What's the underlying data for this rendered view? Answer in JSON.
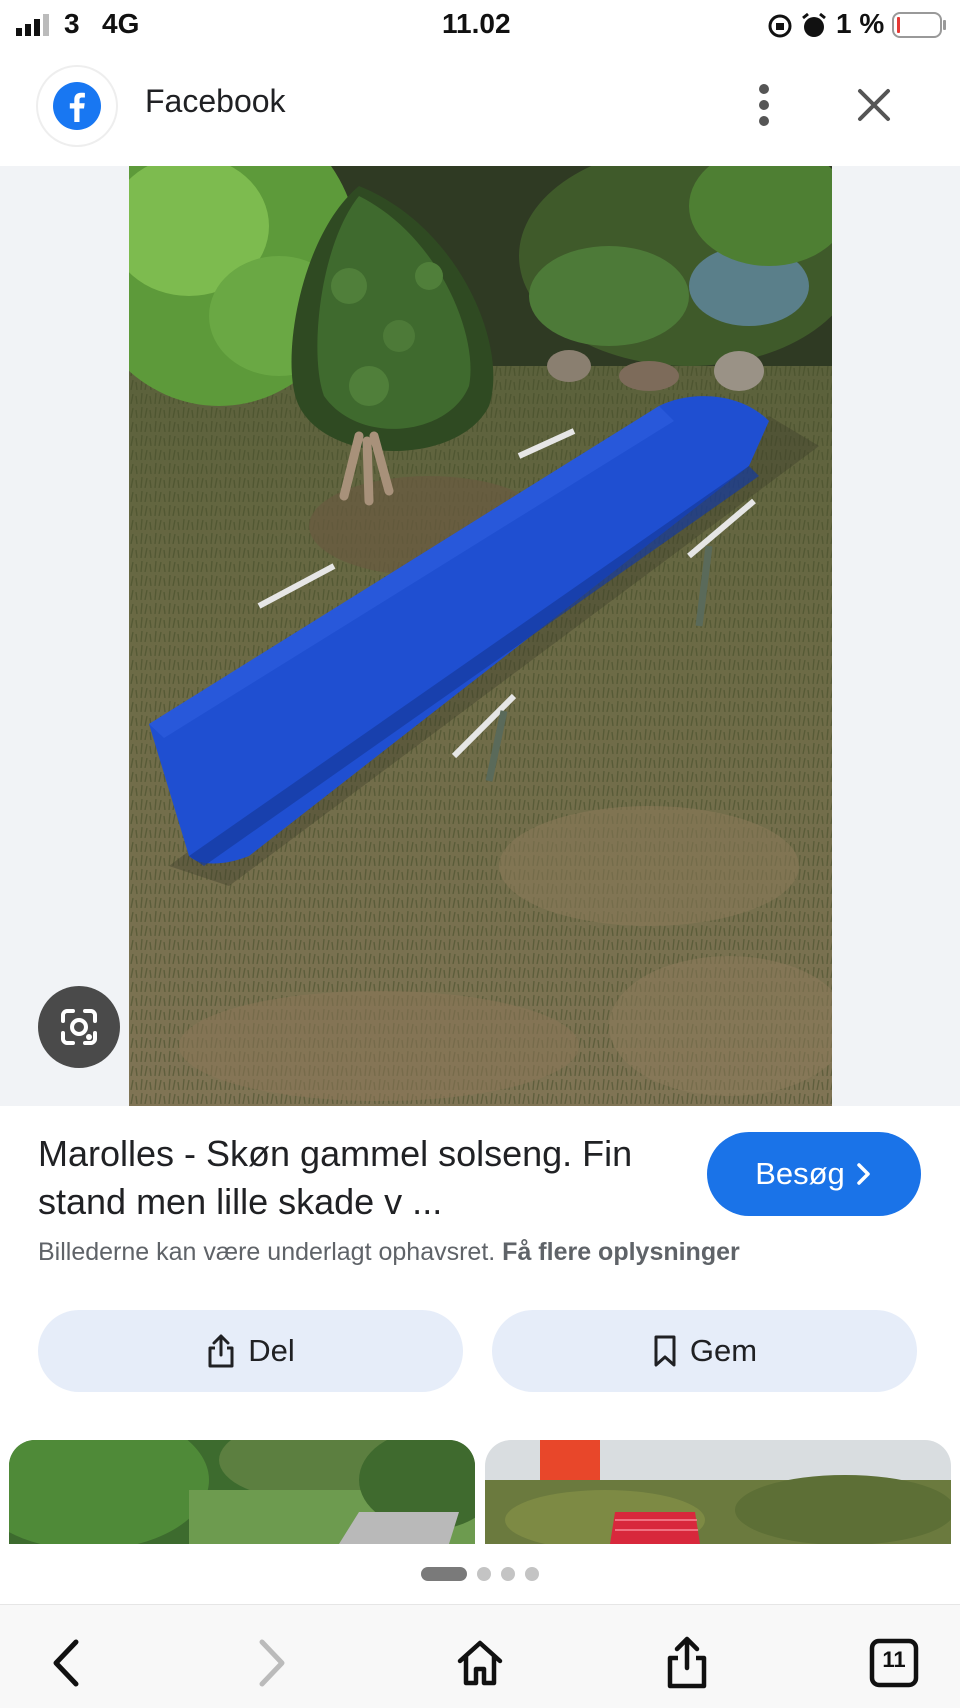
{
  "status_bar": {
    "carrier": "3",
    "network": "4G",
    "time": "11.02",
    "battery": "1 %"
  },
  "header": {
    "title": "Facebook",
    "icons": [
      "facebook-logo-icon",
      "more-vert-icon",
      "close-icon"
    ]
  },
  "result": {
    "title": "Marolles - Skøn gammel solseng. Fin stand men lille skade v ...",
    "visit_label": "Besøg",
    "notice_text": "Billederne kan være underlagt ophavsret.",
    "notice_link": "Få flere oplysninger",
    "share_label": "Del",
    "save_label": "Gem"
  },
  "pager": {
    "total": 4,
    "active": 1
  },
  "toolbar": {
    "tabs_count": "11",
    "icons": [
      "back-icon",
      "forward-icon",
      "home-icon",
      "share-icon",
      "tabs-icon"
    ]
  },
  "colors": {
    "accent": "#1a73e8",
    "pill_bg": "#e6edf9",
    "lounger_blue": "#1f4fd1"
  }
}
